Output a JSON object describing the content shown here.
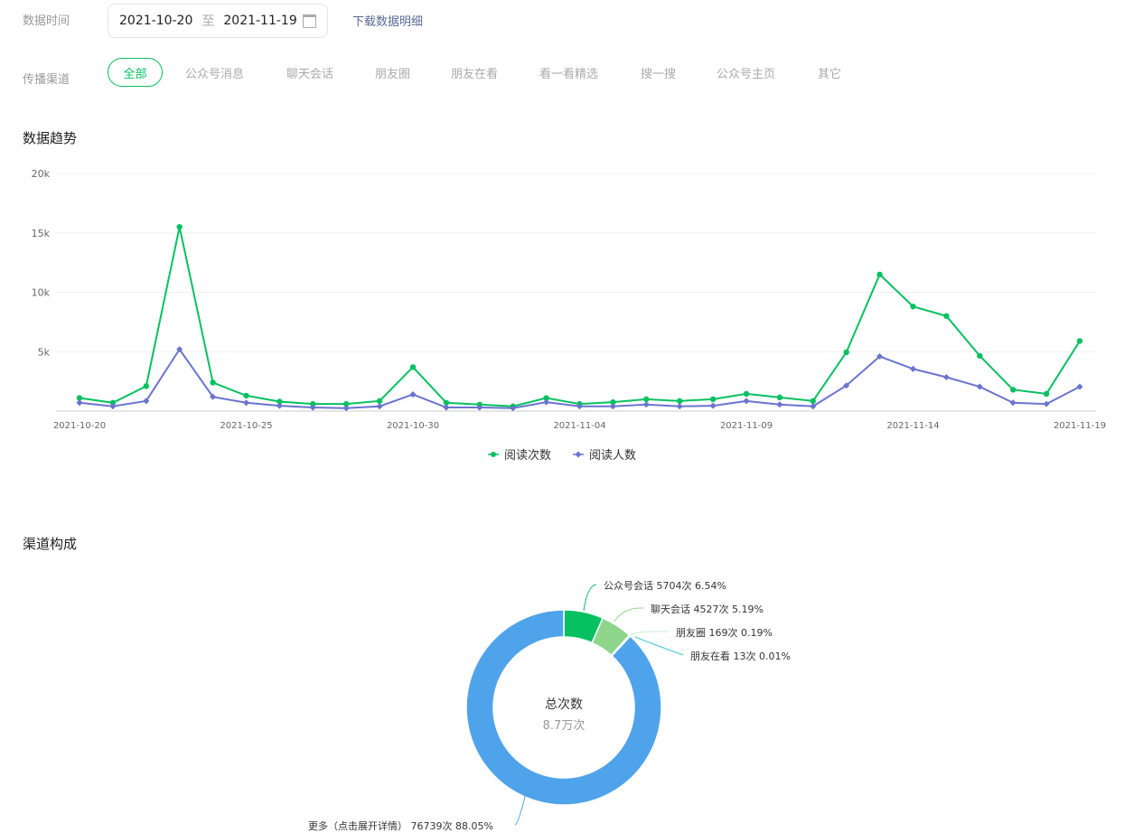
{
  "filters": {
    "date_label": "数据时间",
    "start": "2021-10-20",
    "to": "至",
    "end": "2021-11-19",
    "download": "下载数据明细",
    "channel_label": "传播渠道",
    "channels": [
      "全部",
      "公众号消息",
      "聊天会话",
      "朋友圈",
      "朋友在看",
      "看一看精选",
      "搜一搜",
      "公众号主页",
      "其它"
    ]
  },
  "trend": {
    "title": "数据趋势"
  },
  "chart_data": {
    "type": "line",
    "title": "数据趋势",
    "ylim": [
      0,
      20000
    ],
    "yticks": [
      "",
      "5k",
      "10k",
      "15k",
      "20k"
    ],
    "x_ticks": [
      "2021-10-20",
      "2021-10-25",
      "2021-10-30",
      "2021-11-04",
      "2021-11-09",
      "2021-11-14",
      "2021-11-19"
    ],
    "legend_position": "bottom",
    "series": [
      {
        "name": "阅读次数",
        "color": "#07c160",
        "values": [
          1100,
          700,
          2100,
          15500,
          2400,
          1300,
          800,
          600,
          600,
          850,
          3700,
          700,
          550,
          400,
          1100,
          600,
          750,
          1000,
          850,
          1000,
          1450,
          1150,
          850,
          4950,
          11500,
          8800,
          8000,
          4650,
          1800,
          1450,
          5900
        ]
      },
      {
        "name": "阅读人数",
        "color": "#6b74cf",
        "values": [
          700,
          400,
          850,
          5200,
          1200,
          700,
          450,
          300,
          250,
          400,
          1400,
          300,
          300,
          250,
          750,
          400,
          400,
          550,
          400,
          450,
          850,
          550,
          400,
          2150,
          4600,
          3550,
          2850,
          2050,
          700,
          600,
          2050
        ]
      }
    ]
  },
  "composition": {
    "title": "渠道构成",
    "center_title": "总次数",
    "center_value": "8.7万次",
    "slices": [
      {
        "label": "公众号会话 5704次 6.54%",
        "value": 5704,
        "color": "#07c160"
      },
      {
        "label": "聊天会话 4527次 5.19%",
        "value": 4527,
        "color": "#8fd68c"
      },
      {
        "label": "朋友圈 169次 0.19%",
        "value": 169,
        "color": "#c8efd0"
      },
      {
        "label": "朋友在看 13次 0.01%",
        "value": 13,
        "color": "#3ec6d8"
      },
      {
        "label": "更多（点击展开详情） 76739次 88.05%",
        "value": 76739,
        "color": "#4fa3ea"
      }
    ]
  }
}
